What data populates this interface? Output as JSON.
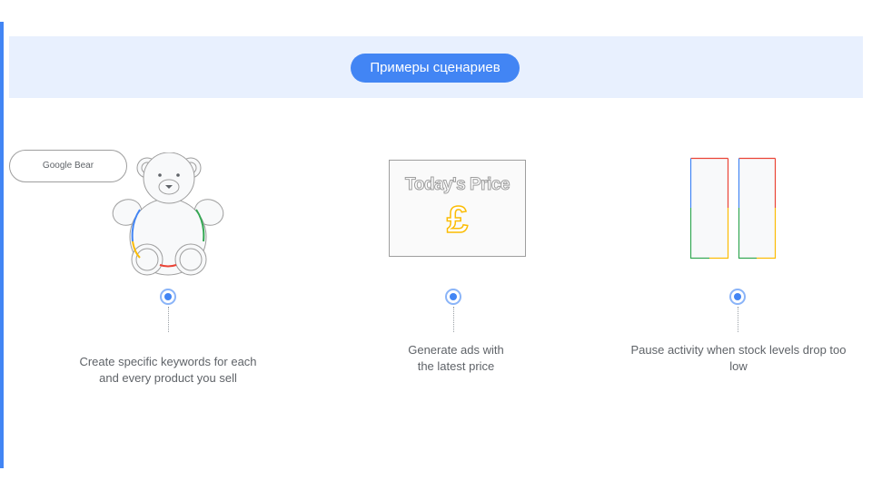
{
  "banner": {
    "title": "Примеры сценариев"
  },
  "scenarios": [
    {
      "tag": "Google Bear",
      "illustration": "teddy-bear",
      "caption": "Create specific keywords for each and every product you sell"
    },
    {
      "illustration": "price-card",
      "card_title": "Today's Price",
      "card_symbol": "£",
      "caption": "Generate ads with the latest price"
    },
    {
      "illustration": "stock-bars",
      "caption": "Pause activity when stock levels drop too low"
    }
  ],
  "colors": {
    "accent": "#4285f4",
    "banner_bg": "#e8f0fe",
    "google_blue": "#4285f4",
    "google_red": "#ea4335",
    "google_yellow": "#fbbc04",
    "google_green": "#34a853"
  }
}
